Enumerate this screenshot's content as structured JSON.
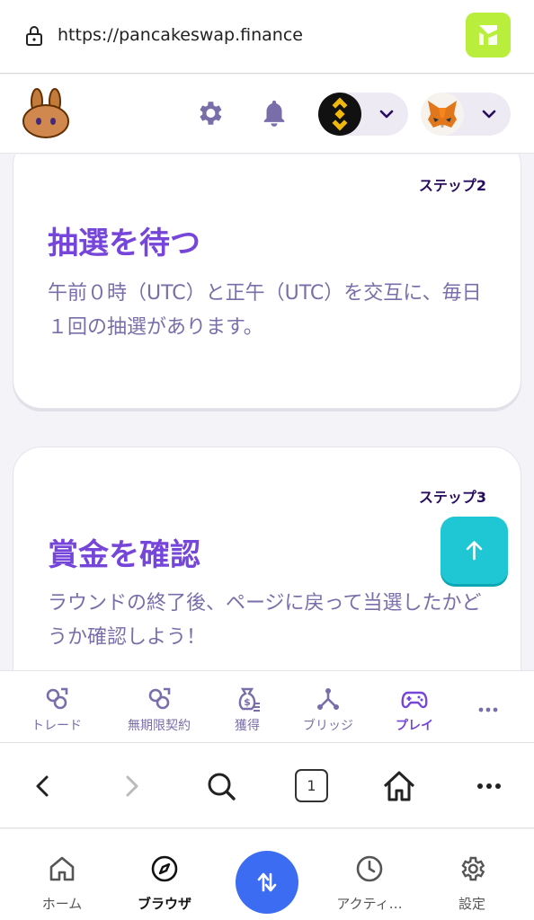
{
  "browser": {
    "url": "https://pancakeswap.finance",
    "tab_count": "1"
  },
  "cards": [
    {
      "step": "ステップ2",
      "title": "抽選を待つ",
      "body": "午前０時（UTC）と正午（UTC）を交互に、毎日１回の抽選があります。"
    },
    {
      "step": "ステップ3",
      "title": "賞金を確認",
      "body": "ラウンドの終了後、ページに戻って当選したかどうか確認しよう！"
    }
  ],
  "app_nav": {
    "items": [
      {
        "label": "トレード",
        "icon": "trade-icon"
      },
      {
        "label": "無期限契約",
        "icon": "perpetual-icon"
      },
      {
        "label": "獲得",
        "icon": "earn-icon"
      },
      {
        "label": "ブリッジ",
        "icon": "bridge-icon"
      },
      {
        "label": "プレイ",
        "icon": "gamepad-icon",
        "active": true
      },
      {
        "label": "",
        "icon": "more-icon"
      }
    ]
  },
  "wallet_tabs": {
    "items": [
      {
        "label": "ホーム",
        "icon": "home-icon"
      },
      {
        "label": "ブラウザ",
        "icon": "compass-icon",
        "active": true
      },
      {
        "label": "",
        "icon": "swap-icon"
      },
      {
        "label": "アクティ…",
        "icon": "clock-icon"
      },
      {
        "label": "設定",
        "icon": "gear-icon"
      }
    ]
  },
  "colors": {
    "primary": "#7645d9",
    "text_secondary": "#7a6eaa",
    "heading": "#280d5f",
    "accent": "#1fc7d4",
    "swap_blue": "#3c6cf2",
    "wallet_logo": "#b9ee3c"
  }
}
